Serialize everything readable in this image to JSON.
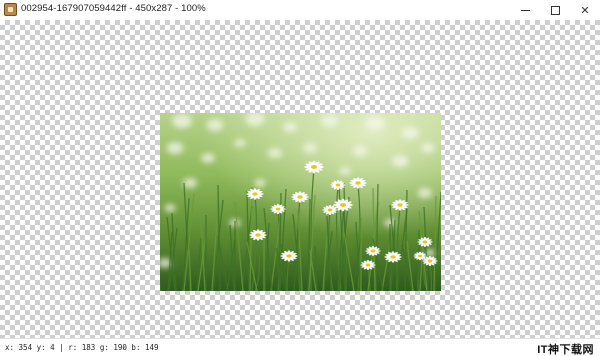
{
  "window": {
    "title": "002954-167907059442ff - 450x287 - 100%",
    "controls": [
      "minimize",
      "maximize",
      "close"
    ],
    "close_glyph": "✕"
  },
  "canvas": {
    "background": "transparency-checkerboard",
    "image": {
      "subject": "field of white daisies with yellow centers on blurred green grass",
      "colors": {
        "grass_dark": "#2f5a1e",
        "grass_light": "#9fc46a",
        "petal": "#ffffff",
        "center": "#f2c421"
      }
    }
  },
  "status": {
    "pixel_info": "x: 354 y: 4 | r: 183 g: 190 b: 149",
    "watermark": "IT神下载网"
  }
}
